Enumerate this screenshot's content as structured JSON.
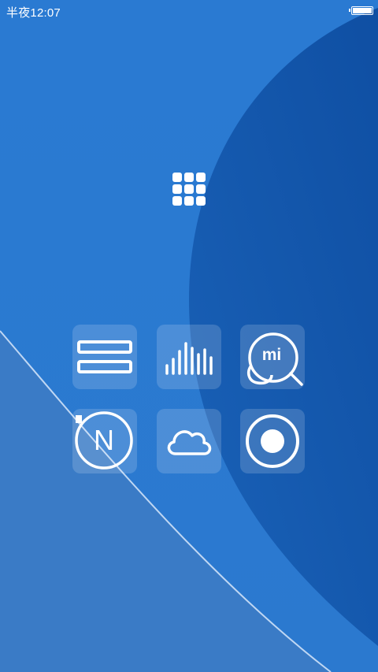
{
  "status_bar": {
    "time": "半夜12:07",
    "battery_icon": "battery-full-icon"
  },
  "home": {
    "app_drawer_icon": "app-grid-icon",
    "tiles": [
      {
        "icon": "list-icon"
      },
      {
        "icon": "equalizer-icon"
      },
      {
        "icon": "chat-bubbles-icon",
        "label": "mi"
      },
      {
        "icon": "n-circle-icon",
        "label": "N"
      },
      {
        "icon": "cloud-icon"
      },
      {
        "icon": "record-icon"
      }
    ]
  },
  "colors": {
    "wallpaper_base": "#2b7ad0",
    "wallpaper_dark": "#1255a8",
    "tile_overlay": "rgba(255,255,255,0.16)"
  }
}
